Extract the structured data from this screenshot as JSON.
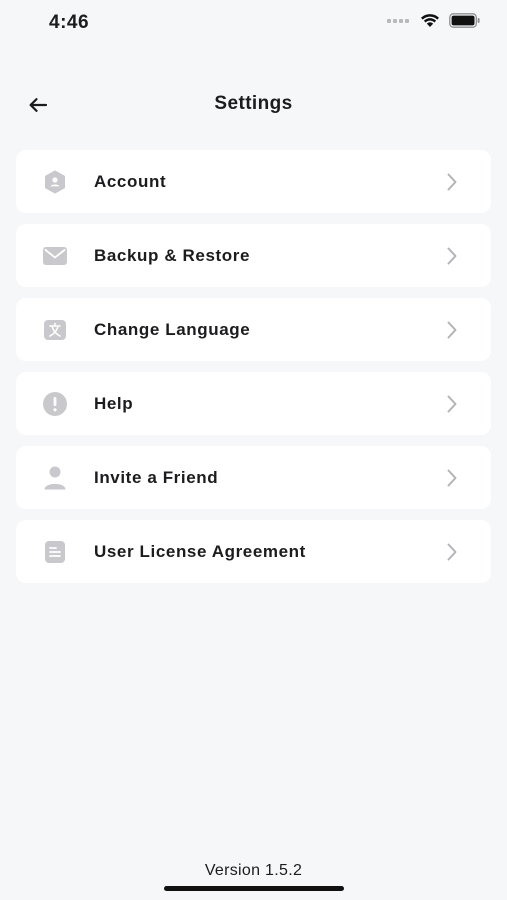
{
  "status_bar": {
    "time": "4:46"
  },
  "header": {
    "title": "Settings"
  },
  "settings": {
    "items": [
      {
        "label": "Account",
        "icon": "account-badge-icon"
      },
      {
        "label": "Backup & Restore",
        "icon": "envelope-icon"
      },
      {
        "label": "Change Language",
        "icon": "language-icon"
      },
      {
        "label": "Help",
        "icon": "exclamation-circle-icon"
      },
      {
        "label": "Invite a Friend",
        "icon": "person-icon"
      },
      {
        "label": "User License Agreement",
        "icon": "document-icon"
      }
    ]
  },
  "footer": {
    "version": "Version 1.5.2"
  },
  "colors": {
    "background": "#f6f7f9",
    "card": "#ffffff",
    "icon_gray": "#c9c9cd",
    "chevron_gray": "#b3b3b8",
    "text": "#1c1c1e"
  }
}
